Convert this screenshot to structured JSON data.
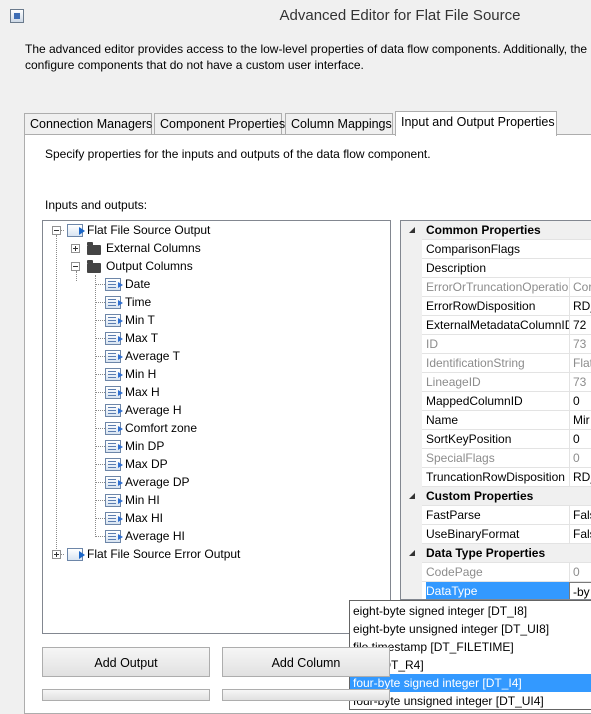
{
  "window": {
    "title": "Advanced Editor for Flat File Source"
  },
  "description": "The advanced editor provides access to the low-level properties of data flow components. Additionally, the\nconfigure components that do not have a custom user interface.",
  "tabs": [
    {
      "label": "Connection Managers"
    },
    {
      "label": "Component Properties"
    },
    {
      "label": "Column Mappings"
    },
    {
      "label": "Input and Output Properties"
    }
  ],
  "panel": {
    "specify_text": "Specify properties for the inputs and outputs of the data flow component.",
    "io_label": "Inputs and outputs:"
  },
  "tree": {
    "root": "Flat File Source Output",
    "external": "External Columns",
    "output_columns": "Output Columns",
    "columns": [
      "Date",
      "Time",
      "Min T",
      "Max T",
      "Average T",
      "Min H",
      "Max H",
      "Average H",
      "Comfort zone",
      "Min DP",
      "Max DP",
      "Average DP",
      "Min HI",
      "Max HI",
      "Average HI"
    ],
    "error_output": "Flat File Source Error Output"
  },
  "properties": {
    "rows": [
      {
        "type": "category",
        "name": "Common Properties",
        "value": ""
      },
      {
        "type": "prop",
        "name": "ComparisonFlags",
        "value": ""
      },
      {
        "type": "prop",
        "name": "Description",
        "value": ""
      },
      {
        "type": "ro",
        "name": "ErrorOrTruncationOperatio",
        "value": "Cor"
      },
      {
        "type": "prop",
        "name": "ErrorRowDisposition",
        "value": "RD_"
      },
      {
        "type": "prop",
        "name": "ExternalMetadataColumnID",
        "value": "72"
      },
      {
        "type": "ro",
        "name": "ID",
        "value": "73"
      },
      {
        "type": "ro",
        "name": "IdentificationString",
        "value": "Flat"
      },
      {
        "type": "ro",
        "name": "LineageID",
        "value": "73"
      },
      {
        "type": "prop",
        "name": "MappedColumnID",
        "value": "0"
      },
      {
        "type": "prop",
        "name": "Name",
        "value": "Mir"
      },
      {
        "type": "prop",
        "name": "SortKeyPosition",
        "value": "0"
      },
      {
        "type": "ro",
        "name": "SpecialFlags",
        "value": "0"
      },
      {
        "type": "prop",
        "name": "TruncationRowDisposition",
        "value": "RD_"
      },
      {
        "type": "category",
        "name": "Custom Properties",
        "value": ""
      },
      {
        "type": "prop",
        "name": "FastParse",
        "value": "Fals"
      },
      {
        "type": "prop",
        "name": "UseBinaryFormat",
        "value": "Fals"
      },
      {
        "type": "category",
        "name": "Data Type Properties",
        "value": ""
      },
      {
        "type": "ro",
        "name": "CodePage",
        "value": "0"
      },
      {
        "type": "selected",
        "name": "DataType",
        "value": "-by"
      }
    ]
  },
  "dropdown": {
    "items": [
      "eight-byte signed integer [DT_I8]",
      "eight-byte unsigned integer [DT_UI8]",
      "file timestamp [DT_FILETIME]",
      "float [DT_R4]",
      "four-byte signed integer [DT_I4]",
      "four-byte unsigned integer [DT_UI4]"
    ],
    "selected_index": 4
  },
  "buttons": {
    "add_output": "Add Output",
    "add_column": "Add Column"
  }
}
